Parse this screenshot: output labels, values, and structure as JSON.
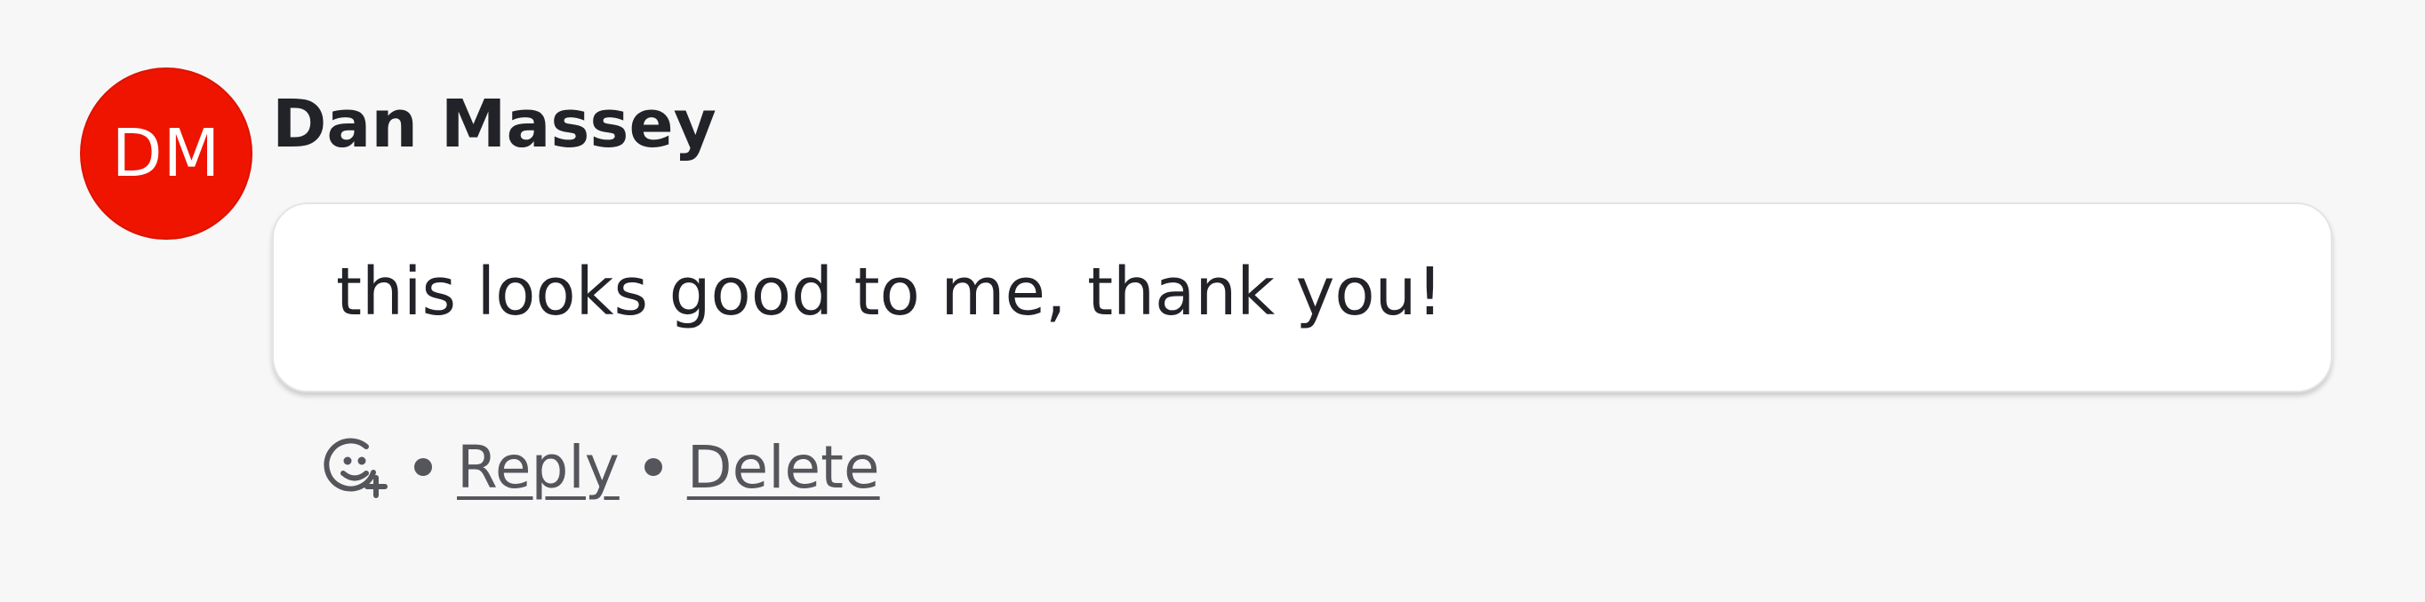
{
  "comment": {
    "avatar": {
      "initials": "DM",
      "color": "#ee1400"
    },
    "author": "Dan Massey",
    "text": "this looks good to me, thank you!",
    "actions": {
      "add_reaction_icon": "add-reaction-icon",
      "reply_label": "Reply",
      "delete_label": "Delete"
    }
  },
  "colors": {
    "background": "#f7f7f7",
    "bubble": "#ffffff",
    "text": "#222328",
    "muted": "#55565c"
  }
}
